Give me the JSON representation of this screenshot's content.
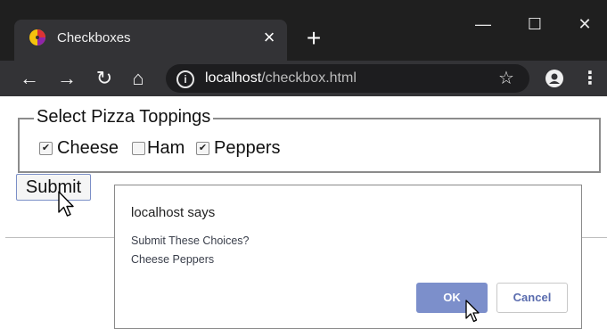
{
  "browser": {
    "tab_title": "Checkboxes",
    "tab_close_label": "×",
    "new_tab_label": "+",
    "url_host": "localhost",
    "url_path": "/checkbox.html",
    "window_controls": {
      "minimize": "—",
      "maximize": "☐",
      "close": "✕"
    },
    "nav_icons": {
      "back": "back-arrow-icon",
      "forward": "forward-arrow-icon",
      "reload": "reload-icon",
      "home": "home-icon"
    }
  },
  "form": {
    "legend": "Select Pizza Toppings",
    "checkboxes": [
      {
        "label": "Cheese",
        "checked": true
      },
      {
        "label": "Ham",
        "checked": false
      },
      {
        "label": "Peppers",
        "checked": true
      }
    ],
    "submit_label": "Submit"
  },
  "dialog": {
    "title": "localhost says",
    "message_line1": "Submit These Choices?",
    "message_line2": "Cheese Peppers",
    "ok_label": "OK",
    "cancel_label": "Cancel"
  },
  "colors": {
    "titlebar": "#1f1f1f",
    "toolbar": "#333336",
    "ok_button": "#7c8fcb",
    "cancel_text": "#5a6cae"
  }
}
